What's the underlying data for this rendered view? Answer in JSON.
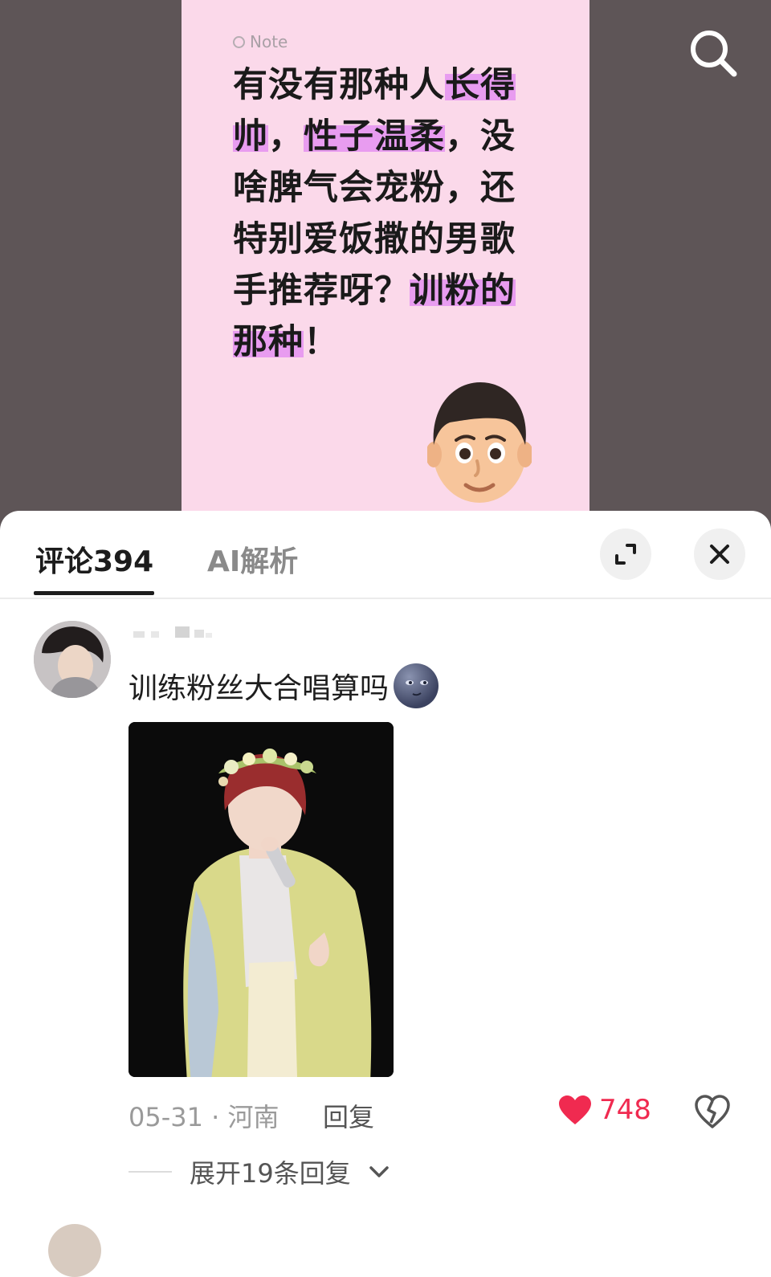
{
  "note": {
    "tag": "Note",
    "segments": [
      {
        "text": "有没有那种人",
        "hl": false
      },
      {
        "text": "长得帅",
        "hl": true
      },
      {
        "text": "，",
        "hl": false
      },
      {
        "text": "性子温柔",
        "hl": true
      },
      {
        "text": "，没啥脾气会宠粉，还特别爱饭撒的男歌手推荐呀？",
        "hl": false
      },
      {
        "text": "训粉的那种",
        "hl": true
      },
      {
        "text": "！",
        "hl": false
      }
    ]
  },
  "tabs": {
    "comments": "评论394",
    "ai": "AI解析"
  },
  "comment": {
    "text": "训练粉丝大合唱算吗",
    "date": "05-31",
    "location": "河南",
    "reply_label": "回复",
    "likes": "748",
    "expand_replies": "展开19条回复"
  },
  "colors": {
    "highlight": "#e89cf0",
    "note_bg": "#fbd9ea",
    "like": "#f02a50"
  }
}
